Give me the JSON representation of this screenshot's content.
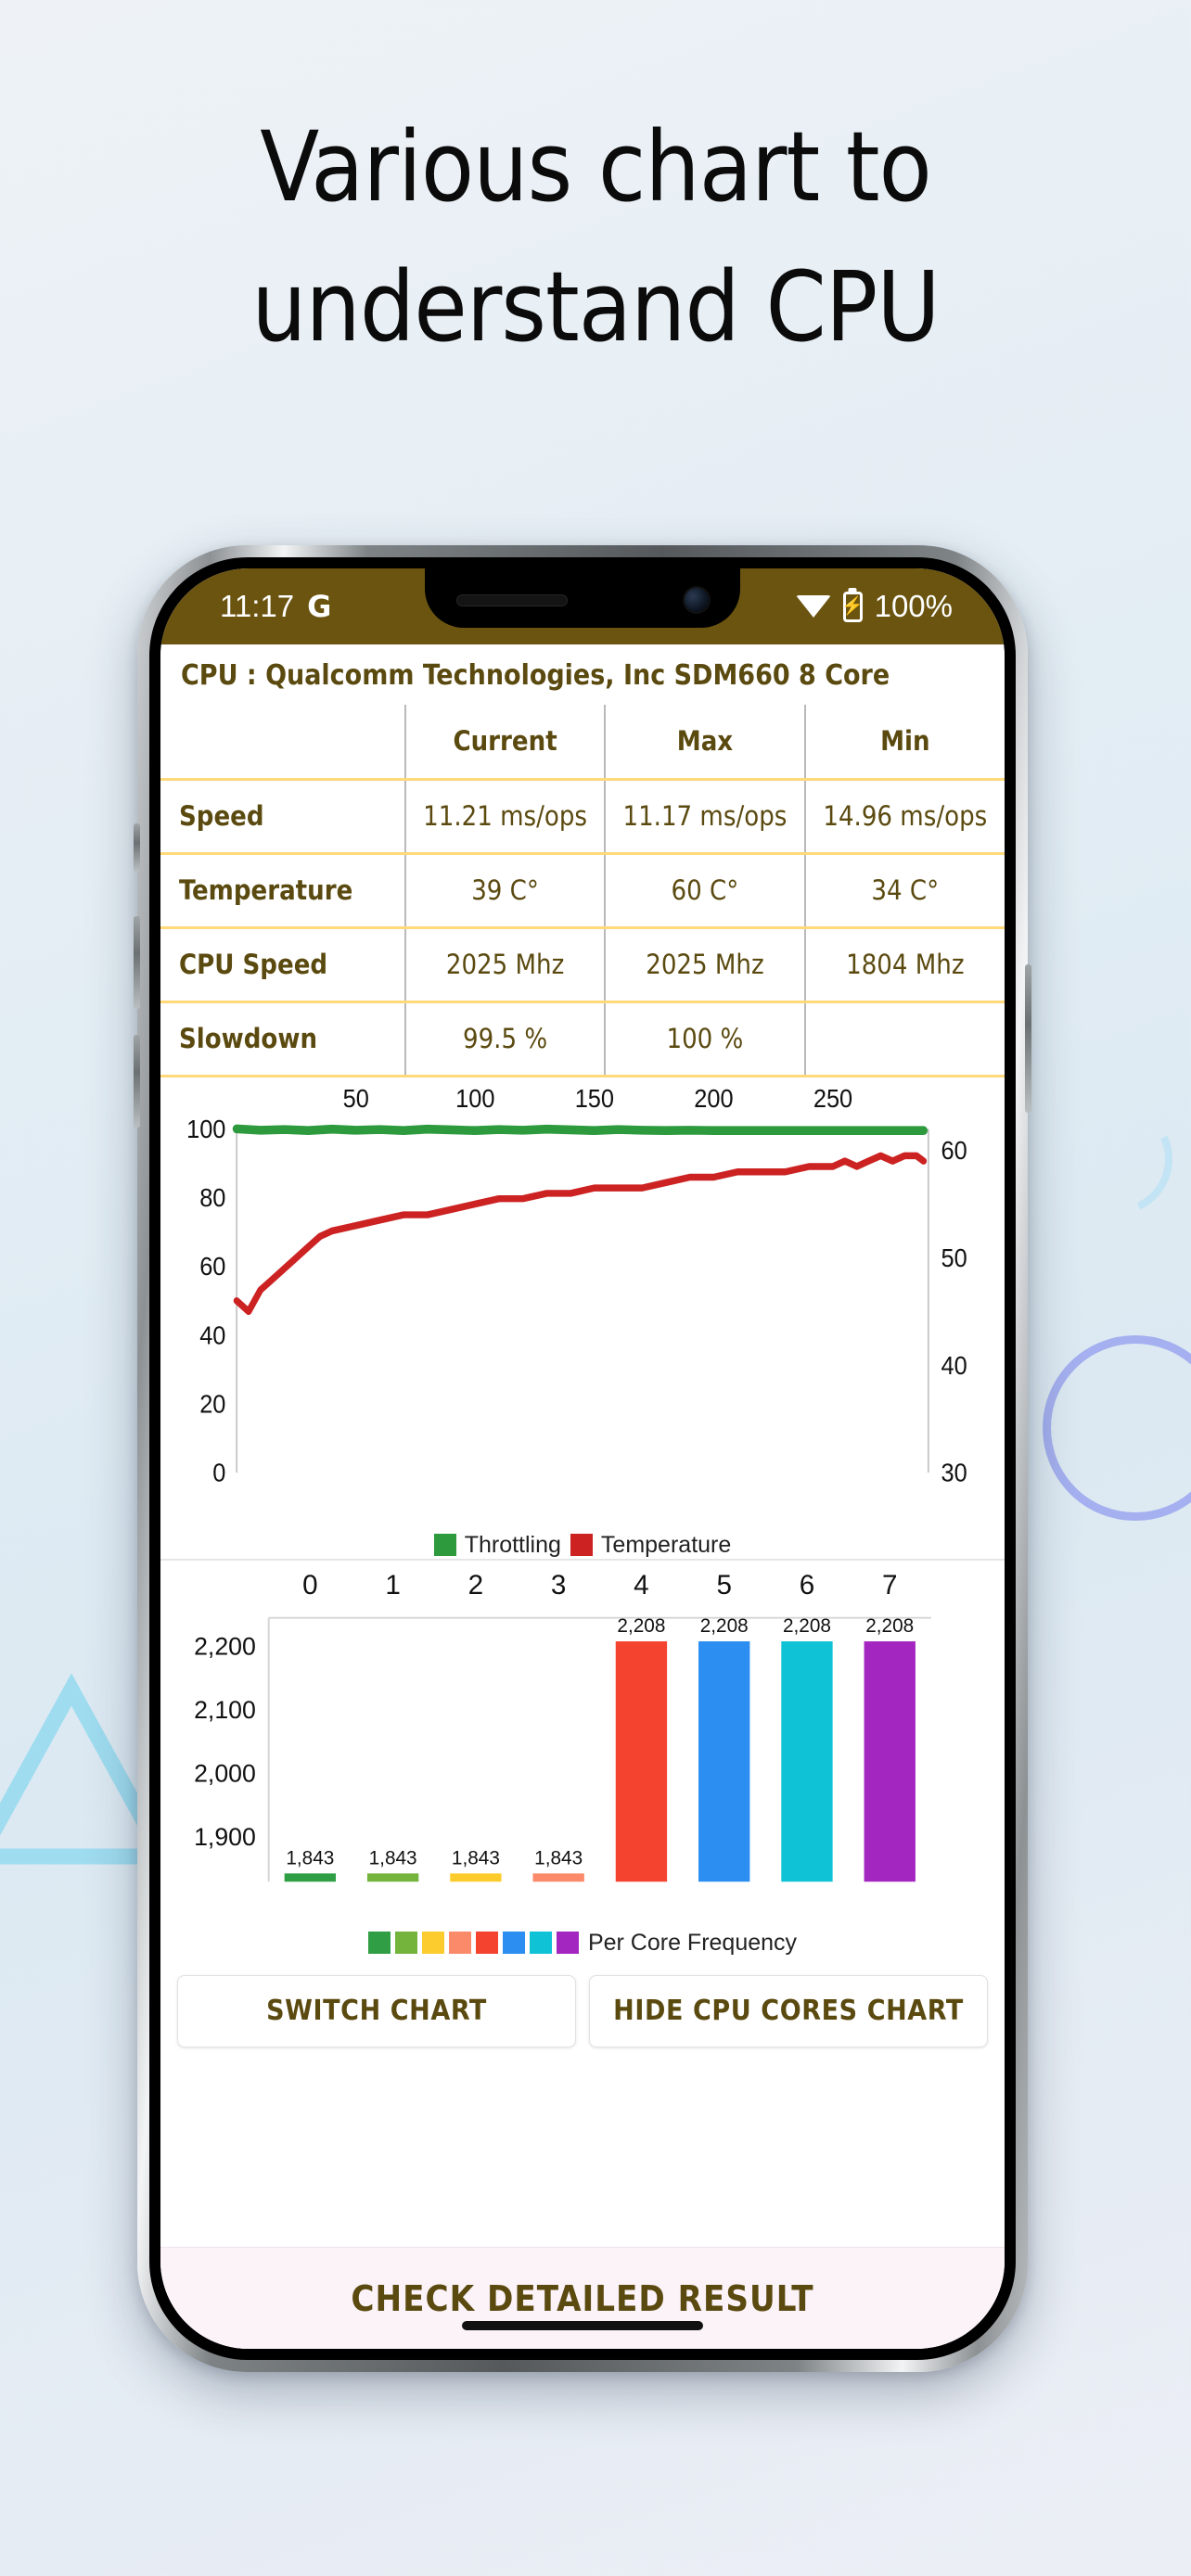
{
  "headline": {
    "line1": "Various chart to",
    "line2": "understand CPU"
  },
  "phone": {
    "status": {
      "time": "11:17",
      "assistant_icon": "google-g-icon",
      "wifi_icon": "wifi-icon",
      "battery_icon": "battery-charging-icon",
      "battery_label": "100%"
    }
  },
  "app": {
    "cpu_title": "CPU : Qualcomm Technologies, Inc SDM660 8 Core",
    "table": {
      "headers": [
        "",
        "Current",
        "Max",
        "Min"
      ],
      "rows": [
        {
          "label": "Speed",
          "current": "11.21 ms/ops",
          "max": "11.17 ms/ops",
          "min": "14.96 ms/ops"
        },
        {
          "label": "Temperature",
          "current": "39 C°",
          "max": "60 C°",
          "min": "34 C°"
        },
        {
          "label": "CPU Speed",
          "current": "2025 Mhz",
          "max": "2025 Mhz",
          "min": "1804 Mhz"
        },
        {
          "label": "Slowdown",
          "current": "99.5 %",
          "max": "100 %",
          "min": ""
        }
      ]
    },
    "buttons": {
      "switch_chart": "SWITCH CHART",
      "hide_cores_chart": "HIDE CPU CORES CHART",
      "check_detailed_result": "CHECK DETAILED RESULT"
    }
  },
  "colors": {
    "accent_brown": "#5b4a10",
    "status_bar": "#6b5410",
    "table_rule": "#ffd97a",
    "value_current": "#2e9a3e",
    "throttling": "#2e9a3e",
    "temperature": "#cc2222",
    "cta_bg": "#fbf3f8"
  },
  "chart_data": [
    {
      "type": "line",
      "title": "",
      "xlabel": "",
      "ylabel": "",
      "x_axis_position": "top",
      "xticks": [
        50,
        100,
        150,
        200,
        250
      ],
      "xlim": [
        0,
        290
      ],
      "left_axis": {
        "label": "Throttling",
        "ticks": [
          0,
          20,
          40,
          60,
          80,
          100
        ],
        "ylim": [
          0,
          100
        ]
      },
      "right_axis": {
        "label": "Temperature",
        "ticks": [
          30,
          40,
          50,
          60
        ],
        "ylim": [
          30,
          62
        ]
      },
      "grid": false,
      "legend": {
        "position": "bottom",
        "entries": [
          "Throttling",
          "Temperature"
        ]
      },
      "series": [
        {
          "name": "Throttling",
          "color": "#2e9a3e",
          "axis": "left",
          "x": [
            0,
            10,
            20,
            30,
            40,
            50,
            60,
            70,
            80,
            90,
            100,
            110,
            120,
            130,
            140,
            150,
            160,
            170,
            180,
            190,
            200,
            210,
            220,
            230,
            240,
            250,
            260,
            270,
            280,
            288
          ],
          "values": [
            100,
            99.6,
            99.8,
            99.5,
            99.9,
            99.6,
            99.8,
            99.5,
            99.9,
            99.7,
            99.5,
            99.8,
            99.6,
            99.9,
            99.7,
            99.5,
            99.8,
            99.6,
            99.5,
            99.6,
            99.5,
            99.5,
            99.5,
            99.5,
            99.5,
            99.5,
            99.5,
            99.5,
            99.5,
            99.5
          ]
        },
        {
          "name": "Temperature",
          "color": "#cc2222",
          "axis": "right",
          "x": [
            0,
            5,
            10,
            15,
            20,
            25,
            30,
            35,
            40,
            50,
            60,
            70,
            80,
            90,
            100,
            110,
            120,
            130,
            140,
            150,
            160,
            170,
            180,
            190,
            200,
            210,
            220,
            230,
            240,
            250,
            255,
            260,
            265,
            270,
            275,
            280,
            285,
            288
          ],
          "values": [
            46,
            45,
            47,
            48,
            49,
            50,
            51,
            52,
            52.5,
            53,
            53.5,
            54,
            54,
            54.5,
            55,
            55.5,
            55.5,
            56,
            56,
            56.5,
            56.5,
            56.5,
            57,
            57.5,
            57.5,
            58,
            58,
            58,
            58.5,
            58.5,
            59,
            58.5,
            59,
            59.5,
            59,
            59.5,
            59.5,
            59
          ]
        }
      ]
    },
    {
      "type": "bar",
      "title": "",
      "xlabel": "",
      "ylabel": "",
      "x_axis_position": "top",
      "categories": [
        "0",
        "1",
        "2",
        "3",
        "4",
        "5",
        "6",
        "7"
      ],
      "values": [
        1843,
        1843,
        1843,
        1843,
        2208,
        2208,
        2208,
        2208
      ],
      "data_labels": [
        "1,843",
        "1,843",
        "1,843",
        "1,843",
        "2,208",
        "2,208",
        "2,208",
        "2,208"
      ],
      "yticks": [
        1900,
        2000,
        2100,
        2200
      ],
      "ytick_labels": [
        "1,900",
        "2,000",
        "2,100",
        "2,200"
      ],
      "ylim": [
        1830,
        2245
      ],
      "bar_colors": [
        "#2f9e44",
        "#74b33c",
        "#fccc2e",
        "#fb8a6a",
        "#f4432e",
        "#2b8ef0",
        "#0fc2d6",
        "#a426c1"
      ],
      "grid": false,
      "legend": {
        "position": "bottom",
        "entries": [
          "Per Core Frequency"
        ],
        "swatches": [
          "#2f9e44",
          "#74b33c",
          "#fccc2e",
          "#fb8a6a",
          "#f4432e",
          "#2b8ef0",
          "#0fc2d6",
          "#a426c1"
        ]
      }
    }
  ]
}
